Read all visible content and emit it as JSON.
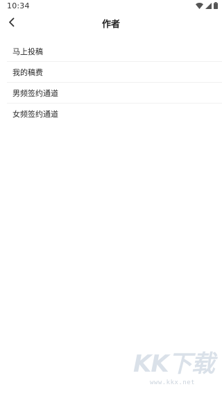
{
  "status_bar": {
    "time": "10:34",
    "icons": [
      "wifi-icon",
      "cellular-signal-icon",
      "battery-icon"
    ]
  },
  "app_bar": {
    "back_icon": "chevron-left-icon",
    "title": "作者"
  },
  "menu": {
    "items": [
      {
        "label": "马上投稿"
      },
      {
        "label": "我的稿费"
      },
      {
        "label": "男频签约通道"
      },
      {
        "label": "女频签约通道"
      }
    ]
  },
  "watermark": {
    "logo_text": "KK下载",
    "url": "www.kkx.net"
  }
}
